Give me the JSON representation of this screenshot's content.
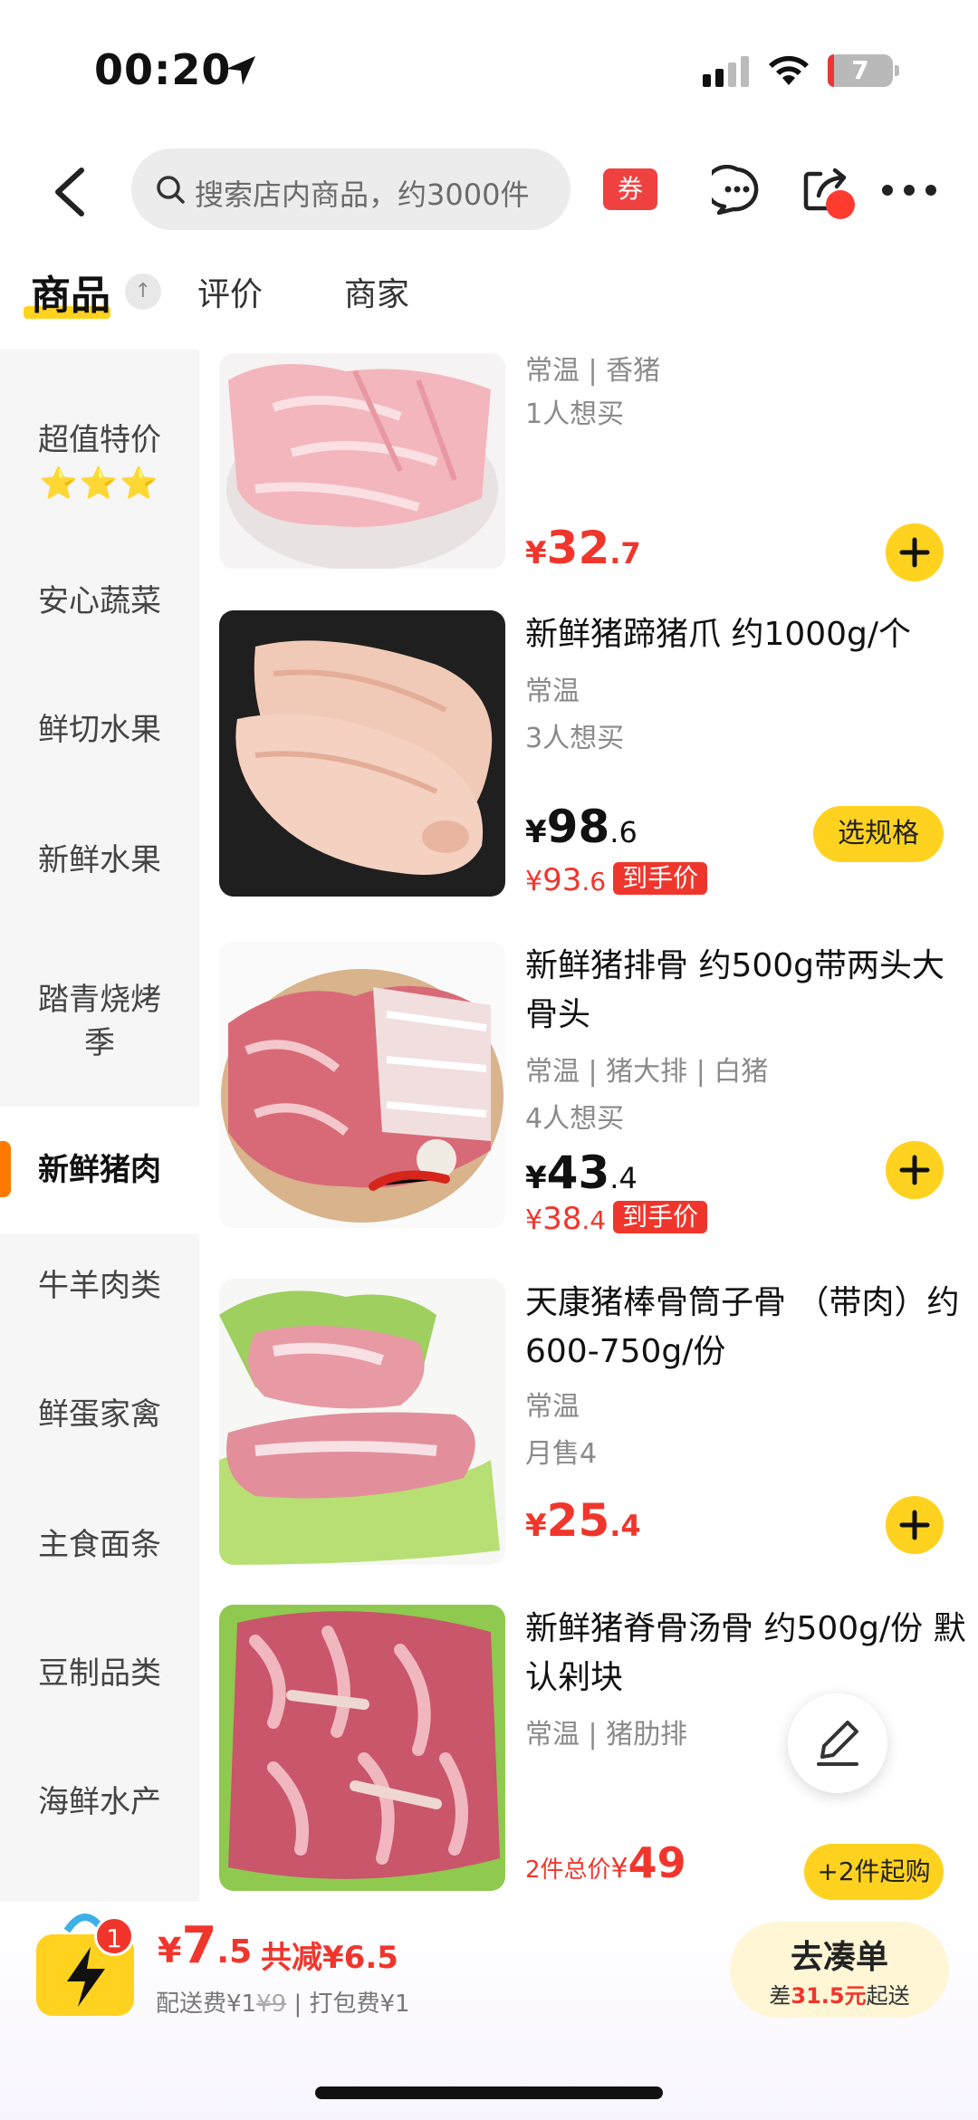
{
  "status_bar": {
    "time": "00:20",
    "battery": "7"
  },
  "header": {
    "search_placeholder": "搜索店内商品，约3000件",
    "coupon_label": "券"
  },
  "tabs": {
    "products": "商品",
    "reviews": "评价",
    "merchant": "商家"
  },
  "sidebar": {
    "items": [
      {
        "label": "超值特价",
        "stars": "⭐⭐⭐"
      },
      {
        "label": "安心蔬菜"
      },
      {
        "label": "鲜切水果"
      },
      {
        "label": "新鲜水果"
      },
      {
        "label": "踏青烧烤季"
      },
      {
        "label": "新鲜猪肉",
        "active": true
      },
      {
        "label": "牛羊肉类"
      },
      {
        "label": "鲜蛋家禽"
      },
      {
        "label": "主食面条"
      },
      {
        "label": "豆制品类"
      },
      {
        "label": "海鲜水产"
      }
    ]
  },
  "products": [
    {
      "title": "",
      "attrs": "常温 | 香猪",
      "wants": "1人想买",
      "price_int": "32",
      "price_dec": ".7",
      "currency": "¥"
    },
    {
      "title": "新鲜猪蹄猪爪 约1000g/个",
      "attrs": "常温",
      "wants": "3人想买",
      "price_int": "98",
      "price_dec": ".6",
      "deal_int": "93",
      "deal_dec": ".6",
      "deal_label": "到手价",
      "action": "选规格",
      "currency": "¥"
    },
    {
      "title": "新鲜猪排骨 约500g带两头大骨头",
      "attrs": "常温 | 猪大排 | 白猪",
      "wants": "4人想买",
      "price_int": "43",
      "price_dec": ".4",
      "deal_int": "38",
      "deal_dec": ".4",
      "deal_label": "到手价",
      "currency": "¥"
    },
    {
      "title": "天康猪棒骨筒子骨 （带肉）约600-750g/份",
      "attrs": "常温",
      "wants": "月售4",
      "price_int": "25",
      "price_dec": ".4",
      "currency": "¥"
    },
    {
      "title": "新鲜猪脊骨汤骨 约500g/份 默认剁块",
      "attrs": "常温 | 猪肋排",
      "multi_label": "2件总价",
      "multi_price": "49",
      "action": "+2件起购",
      "currency": "¥"
    }
  ],
  "cart": {
    "badge": "1",
    "currency": "¥",
    "total_int": "7",
    "total_dec": ".5",
    "discount": "共减¥6.5",
    "fee_prefix": "配送费¥1",
    "fee_original": "¥9",
    "fee_suffix": " | 打包费¥1",
    "go_label": "去凑单",
    "diff_prefix": "差",
    "diff_amount": "31.5元",
    "diff_suffix": "起送"
  },
  "colors": {
    "accent": "#ffd21f",
    "price": "#f0362c",
    "active_bar": "#ff7a00"
  }
}
